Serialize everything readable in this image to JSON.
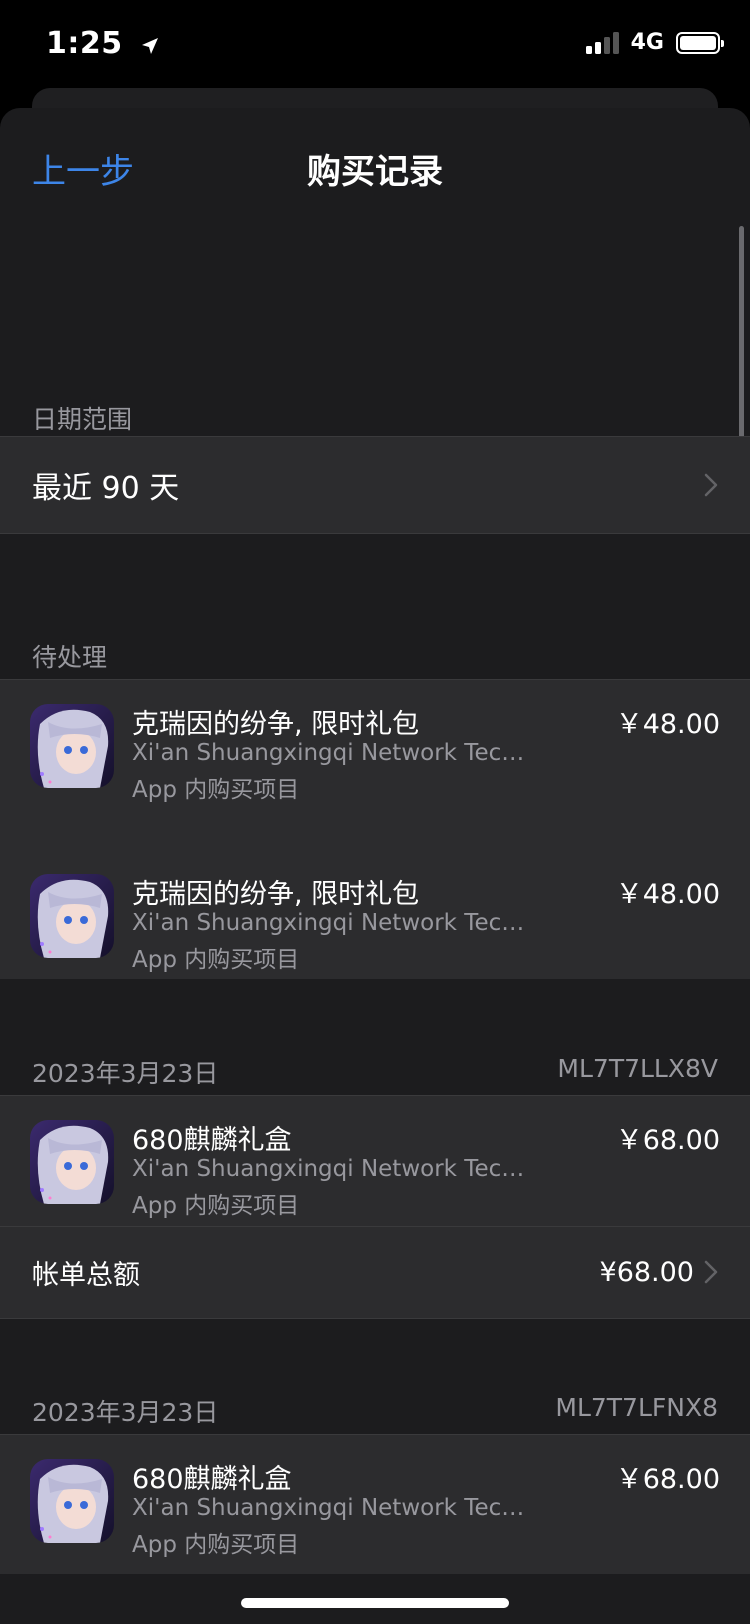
{
  "status": {
    "time": "1:25",
    "network": "4G"
  },
  "nav": {
    "back_label": "上一步",
    "title": "购买记录"
  },
  "date_range": {
    "header": "日期范围",
    "value": "最近 90 天"
  },
  "pending": {
    "header": "待处理",
    "items": [
      {
        "name": "克瑞因的纷争, 限时礼包",
        "developer": "Xi'an Shuangxingqi Network Tech...",
        "kind": "App 内购买项目",
        "price": "￥48.00"
      },
      {
        "name": "克瑞因的纷争, 限时礼包",
        "developer": "Xi'an Shuangxingqi Network Tech...",
        "kind": "App 内购买项目",
        "price": "￥48.00"
      }
    ]
  },
  "orders": [
    {
      "date": "2023年3月23日",
      "order_id": "ML7T7LLX8V",
      "item": {
        "name": "680麒麟礼盒",
        "developer": "Xi'an Shuangxingqi Network Tech...",
        "kind": "App 内购买项目",
        "price": "￥68.00"
      },
      "total_label": "帐单总额",
      "total_value": "¥68.00"
    },
    {
      "date": "2023年3月23日",
      "order_id": "ML7T7LFNX8",
      "item": {
        "name": "680麒麟礼盒",
        "developer": "Xi'an Shuangxingqi Network Tech...",
        "kind": "App 内购买项目",
        "price": "￥68.00"
      }
    }
  ],
  "colors": {
    "accent": "#3d85e8",
    "background": "#1c1c1e",
    "cell": "#2c2c2e",
    "secondary_text": "#98989e"
  },
  "icons": [
    "location-arrow-icon",
    "signal-icon",
    "battery-icon",
    "chevron-right-icon",
    "app-icon"
  ]
}
